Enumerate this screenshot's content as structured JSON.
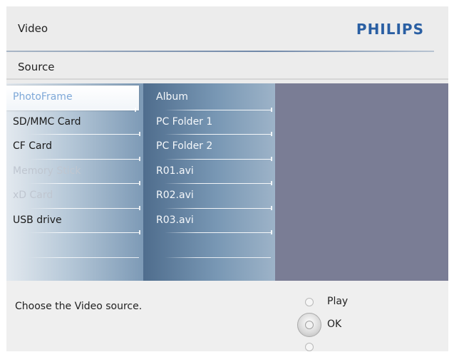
{
  "header": {
    "title": "Video",
    "brand": "PHILIPS"
  },
  "section": {
    "title": "Source"
  },
  "sources": [
    {
      "label": "PhotoFrame",
      "state": "selected"
    },
    {
      "label": "SD/MMC Card",
      "state": "enabled"
    },
    {
      "label": "CF Card",
      "state": "enabled"
    },
    {
      "label": "Memory Stick",
      "state": "disabled"
    },
    {
      "label": "xD Card",
      "state": "disabled"
    },
    {
      "label": "USB drive",
      "state": "enabled"
    }
  ],
  "items": [
    {
      "label": "Album"
    },
    {
      "label": "PC Folder 1"
    },
    {
      "label": "PC Folder 2"
    },
    {
      "label": "R01.avi"
    },
    {
      "label": "R02.avi"
    },
    {
      "label": "R03.avi"
    }
  ],
  "footer": {
    "hint": "Choose the Video source.",
    "play_label": "Play",
    "ok_label": "OK"
  },
  "colors": {
    "brand": "#2a5fa3",
    "selected_text": "#7ea8d8",
    "panel_right": "#7a7d95"
  }
}
